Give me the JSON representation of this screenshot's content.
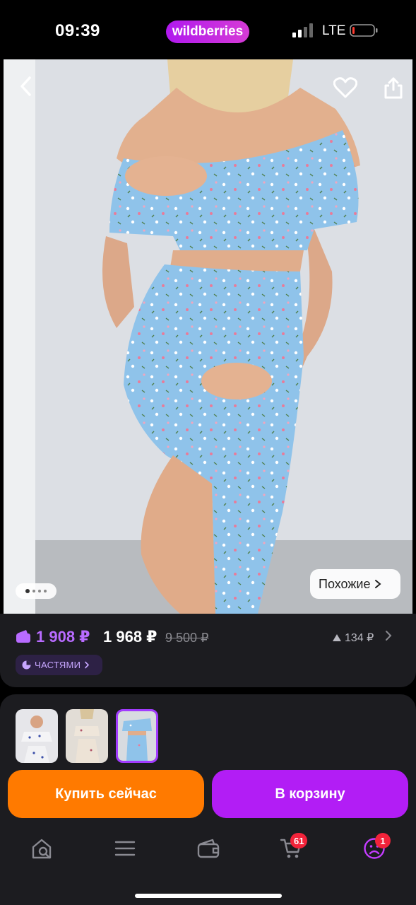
{
  "status_bar": {
    "time": "09:39",
    "brand": "wildberries",
    "network": "LTE"
  },
  "photo": {
    "icons": [
      "back-icon",
      "heart-icon",
      "share-icon"
    ],
    "similar_label": "Похожие",
    "gallery_dots": 4,
    "active_dot": 1
  },
  "price": {
    "wallet_price": "1 908 ₽",
    "regular_price": "1 968 ₽",
    "old_price": "9 500 ₽",
    "price_change": "134 ₽",
    "installments_label": "ЧАСТЯМИ"
  },
  "thumbnails": {
    "count": 3,
    "selected": 3
  },
  "buttons": {
    "buy_now": "Купить сейчас",
    "add_to_cart": "В корзину"
  },
  "nav": {
    "items": [
      "home-search-icon",
      "menu-icon",
      "wallet-icon",
      "cart-icon",
      "profile-icon"
    ],
    "cart_badge": "61",
    "profile_badge": "1"
  },
  "colors": {
    "accent_purple": "#b21df5",
    "accent_orange": "#ff7a00",
    "wallet_price": "#b86bff",
    "badge": "#f2233a",
    "surface": "#1c1c20"
  }
}
